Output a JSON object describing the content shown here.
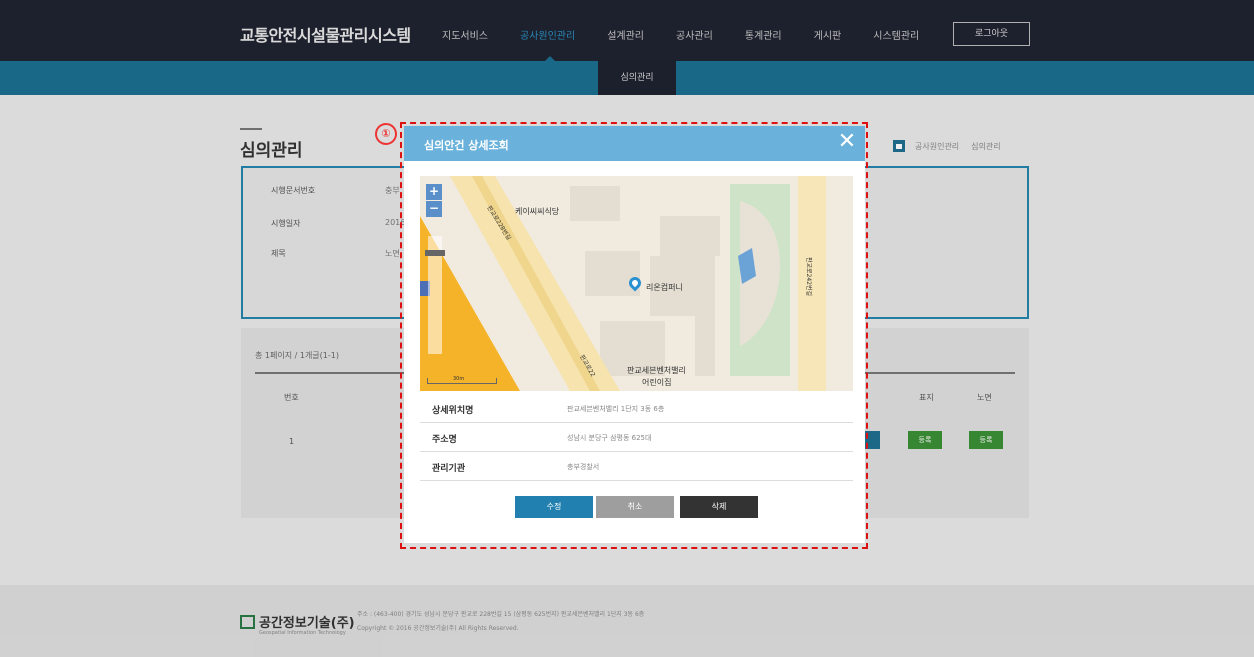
{
  "app": {
    "title": "교통안전시설물관리시스템",
    "logout": "로그아웃"
  },
  "nav": [
    "지도서비스",
    "공사원인관리",
    "설계관리",
    "공사관리",
    "통계관리",
    "게시판",
    "시스템관리"
  ],
  "nav_active_index": 1,
  "subnav": {
    "active": "심의관리"
  },
  "page": {
    "title": "심의관리",
    "breadcrumbs": [
      "공사원인관리",
      "심의관리"
    ]
  },
  "info": {
    "rows": [
      {
        "label": "시행문서번호",
        "value": "충부"
      },
      {
        "label": "시행일자",
        "value": "2016"
      },
      {
        "label": "제목",
        "value": "노면"
      }
    ]
  },
  "list": {
    "count": "총 1페이지 / 1개글(1-1)",
    "headers": {
      "no": "번호",
      "sign": "표지",
      "road": "노면"
    },
    "row": {
      "no": "1",
      "sign_btn": "등록",
      "road_btn": "등록"
    }
  },
  "footer": {
    "logo": "공간정보기술(주)",
    "logo_sub": "Geospatial Information Technology",
    "address": "주소 : (463-400) 경기도 성남시 분당구 판교로 228번길 15 (삼평동 625번지) 판교세븐벤처밸리 1단지 3동 6층",
    "copyright": "Copyright © 2016 공간정보기술(주) All Rights Reserved."
  },
  "modal": {
    "annotation_marker": "①",
    "title": "심의안건 상세조회",
    "close": "✕",
    "map": {
      "zoom_in": "+",
      "zoom_out": "−",
      "labels": {
        "restaurant": "케이씨씨식당",
        "road_diag": "판교로228번길",
        "poi": "리온컴퍼니",
        "road_vert": "판교로242번길",
        "daycare_1": "판교세븐벤처밸리",
        "daycare_2": "어린이집",
        "road_bottom": "판교로22",
        "scale": "30m"
      }
    },
    "details": [
      {
        "key": "상세위치명",
        "value": "판교세븐벤처밸리 1단지 3동 6층"
      },
      {
        "key": "주소명",
        "value": "성남시 분당구 삼평동 625대"
      },
      {
        "key": "관리기관",
        "value": "충부경찰서"
      }
    ],
    "buttons": {
      "edit": "수정",
      "cancel": "취소",
      "delete": "삭제"
    }
  },
  "colors": {
    "topbar": "#1f2230",
    "subbar": "#1c6f90",
    "modal_header": "#6ab2db",
    "annotation": "#dd1111",
    "register_green": "#3b8f36"
  }
}
